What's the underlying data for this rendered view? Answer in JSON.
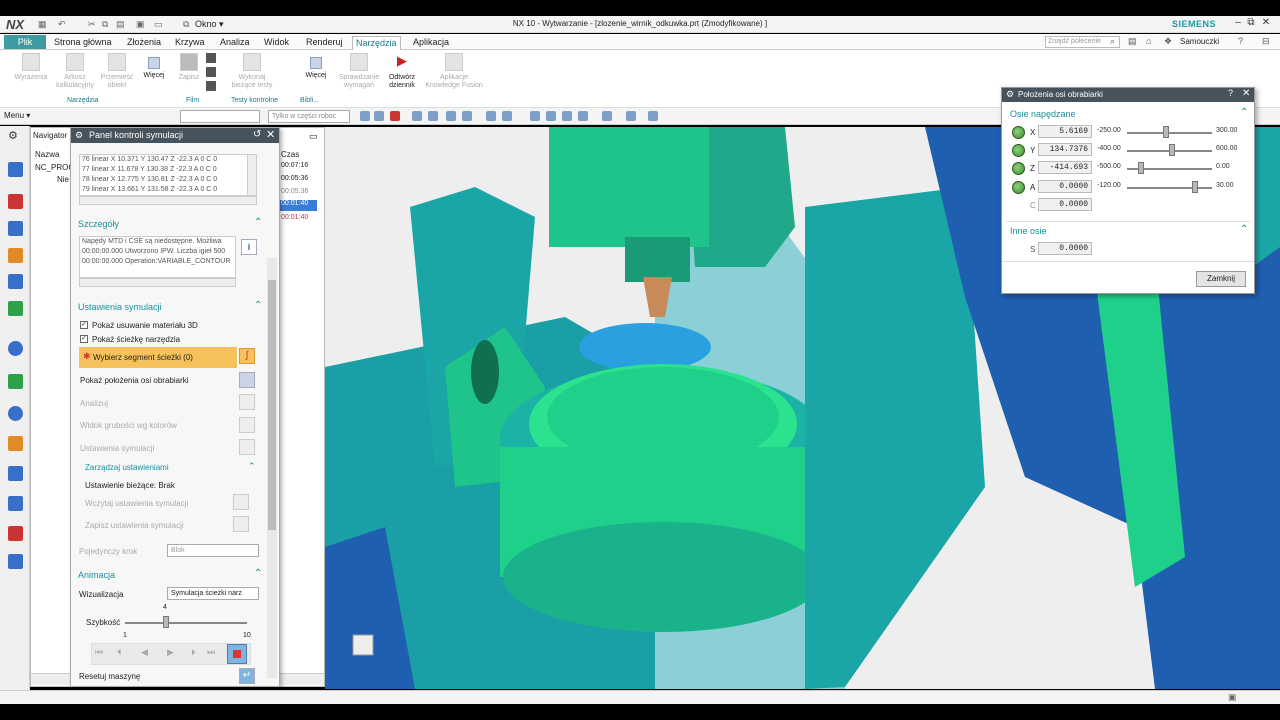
{
  "app": {
    "logo": "NX",
    "window_title": "NX 10 - Wytwarzanie - [zlozenie_wirnik_odkuwka.prt (Zmodyfikowane) ]",
    "brand": "SIEMENS",
    "window_menu": "Okno ▾"
  },
  "menu": {
    "file": "Plik",
    "tabs": [
      "Strona główna",
      "Złożenia",
      "Krzywa",
      "Analiza",
      "Widok",
      "Renderuj",
      "Narzędzia",
      "Aplikacja"
    ],
    "active_index": 6,
    "search_placeholder": "Znajdź polecenie",
    "help": "Samouczki"
  },
  "ribbon": {
    "buttons": [
      {
        "label": "Wyrażenia"
      },
      {
        "label": "Arkusz kalkulacyjny"
      },
      {
        "label": "Przemieść obiekt"
      },
      {
        "label": "Więcej"
      },
      {
        "label": "Zapisz"
      },
      {
        "label": "Wykonaj bieżące testy"
      },
      {
        "label": "Więcej"
      },
      {
        "label": "Sprawdzanie wymagań"
      },
      {
        "label": "Odtwórz dziennik"
      },
      {
        "label": "Aplikacje Knowledge Fusion"
      }
    ],
    "groups": [
      "Narzędzia",
      "Film",
      "Testy kontrolne",
      "Bibli..."
    ],
    "filter_select": "Tylko w części roboc"
  },
  "toolbar2": {
    "menu_label": "Menu ▾"
  },
  "navigator": {
    "title": "Navigator",
    "col_name": "Nazwa",
    "col_time": "Czas",
    "root": "NC_PROG",
    "items": [
      "Nie"
    ],
    "times": [
      "00:07:16",
      "00:05:36",
      "00:05:36",
      "00:01:40",
      "00:01:40"
    ]
  },
  "sim": {
    "title": "Panel kontroli symulacji",
    "path_lines": [
      "76 linear X 10.371 Y 130.47 Z -22.3 A 0 C 0",
      "77 linear X 11.678 Y 130.38 Z -22.3 A 0 C 0",
      "78 linear X 12.775 Y 130.81 Z -22.3 A 0 C 0",
      "79 linear X 13.661 Y 131.58 Z -22.3 A 0 C 0"
    ],
    "details_title": "Szczegóły",
    "details_lines": [
      "Napędy MTD i CSE są niedostępne. Możliwa",
      "00:00:00.000 Utworzono IPW. Liczba igieł 500",
      "00:00:00.000 Operation:VARIABLE_CONTOUR"
    ],
    "settings_title": "Ustawienia symulacji",
    "show_removal": "Pokaż usuwanie materiału 3D",
    "show_path": "Pokaż ścieżkę narzędzia",
    "select_segment": "Wybierz segment ścieżki (0)",
    "show_axes": "Pokaż położenia osi obrabiarki",
    "analysis": "Analizuj",
    "thickness": "Widok grubości wg kolorów",
    "sim_settings": "Ustawienia symulacji",
    "manage": "Zarządzaj ustawieniami",
    "current": "Ustawienie bieżące: Brak",
    "load": "Wczytaj ustawienia symulacji",
    "save": "Zapisz ustawienia symulacji",
    "single_step": "Pojedynczy krok",
    "single_step_value": "Blok",
    "anim_title": "Animacja",
    "visualization": "Wizualizacja",
    "visualization_value": "Symulacja ścieżki narz",
    "speed_label": "Szybkość",
    "speed_value": "4",
    "speed_min": "1",
    "speed_max": "10",
    "speed": 4,
    "reset": "Resetuj maszynę"
  },
  "axes": {
    "title": "Położenia osi obrabiarki",
    "driven_title": "Osie napędzane",
    "items": [
      {
        "name": "X",
        "value": "5.6169",
        "min": "-250.00",
        "max": "300.00",
        "level": 0.46
      },
      {
        "name": "Y",
        "value": "134.7376",
        "min": "-400.00",
        "max": "600.00",
        "level": 0.53
      },
      {
        "name": "Z",
        "value": "-414.693",
        "min": "-500.00",
        "max": "0.00",
        "level": 0.17
      },
      {
        "name": "A",
        "value": "0.0000",
        "min": "-120.00",
        "max": "30.00",
        "level": 0.8
      },
      {
        "name": "C",
        "value": "0.0000"
      }
    ],
    "other_title": "Inne osie",
    "other": [
      {
        "name": "S",
        "value": "0.0000"
      }
    ],
    "close": "Zamknij"
  },
  "colors": {
    "teal": "#1a9ba0",
    "green_machine": "#1fc48a",
    "blue_machine": "#1f5fb0",
    "cyan_block": "#1aa6a6",
    "header": "#46525c",
    "segment_highlight": "#f7c25c"
  }
}
